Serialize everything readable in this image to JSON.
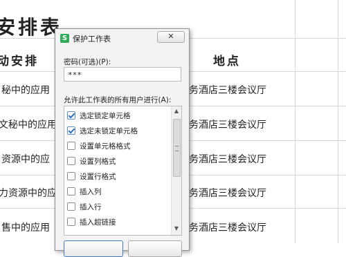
{
  "sheet": {
    "title": "安排表",
    "headers": {
      "activity": "动安排",
      "location": "地点"
    },
    "rows": [
      {
        "activity": "秘中的应用",
        "location": "务酒店三楼会议厅"
      },
      {
        "activity": "文秘中的应用",
        "location": "务酒店三楼会议厅"
      },
      {
        "activity": "资源中的应",
        "location": "务酒店三楼会议厅"
      },
      {
        "activity": "力资源中的应",
        "location": "务酒店三楼会议厅"
      },
      {
        "activity": "售中的应用",
        "location": "务酒店三楼会议厅"
      }
    ]
  },
  "dialog": {
    "app_icon": "S",
    "title": "保护工作表",
    "close_icon": "close-icon",
    "password_label": "密码(可选)(P):",
    "password_value": "***",
    "permissions_label": "允许此工作表的所有用户进行(A):",
    "permissions": [
      {
        "label": "选定锁定单元格",
        "checked": true
      },
      {
        "label": "选定未锁定单元格",
        "checked": true
      },
      {
        "label": "设置单元格格式",
        "checked": false
      },
      {
        "label": "设置列格式",
        "checked": false
      },
      {
        "label": "设置行格式",
        "checked": false
      },
      {
        "label": "插入列",
        "checked": false
      },
      {
        "label": "插入行",
        "checked": false
      },
      {
        "label": "插入超链接",
        "checked": false
      }
    ],
    "scroll_up_icon": "▲",
    "scroll_down_icon": "▼"
  },
  "colors": {
    "accent": "#3f7cc8",
    "app_icon": "#33a95a",
    "checkmark": "#2f6fc1"
  }
}
